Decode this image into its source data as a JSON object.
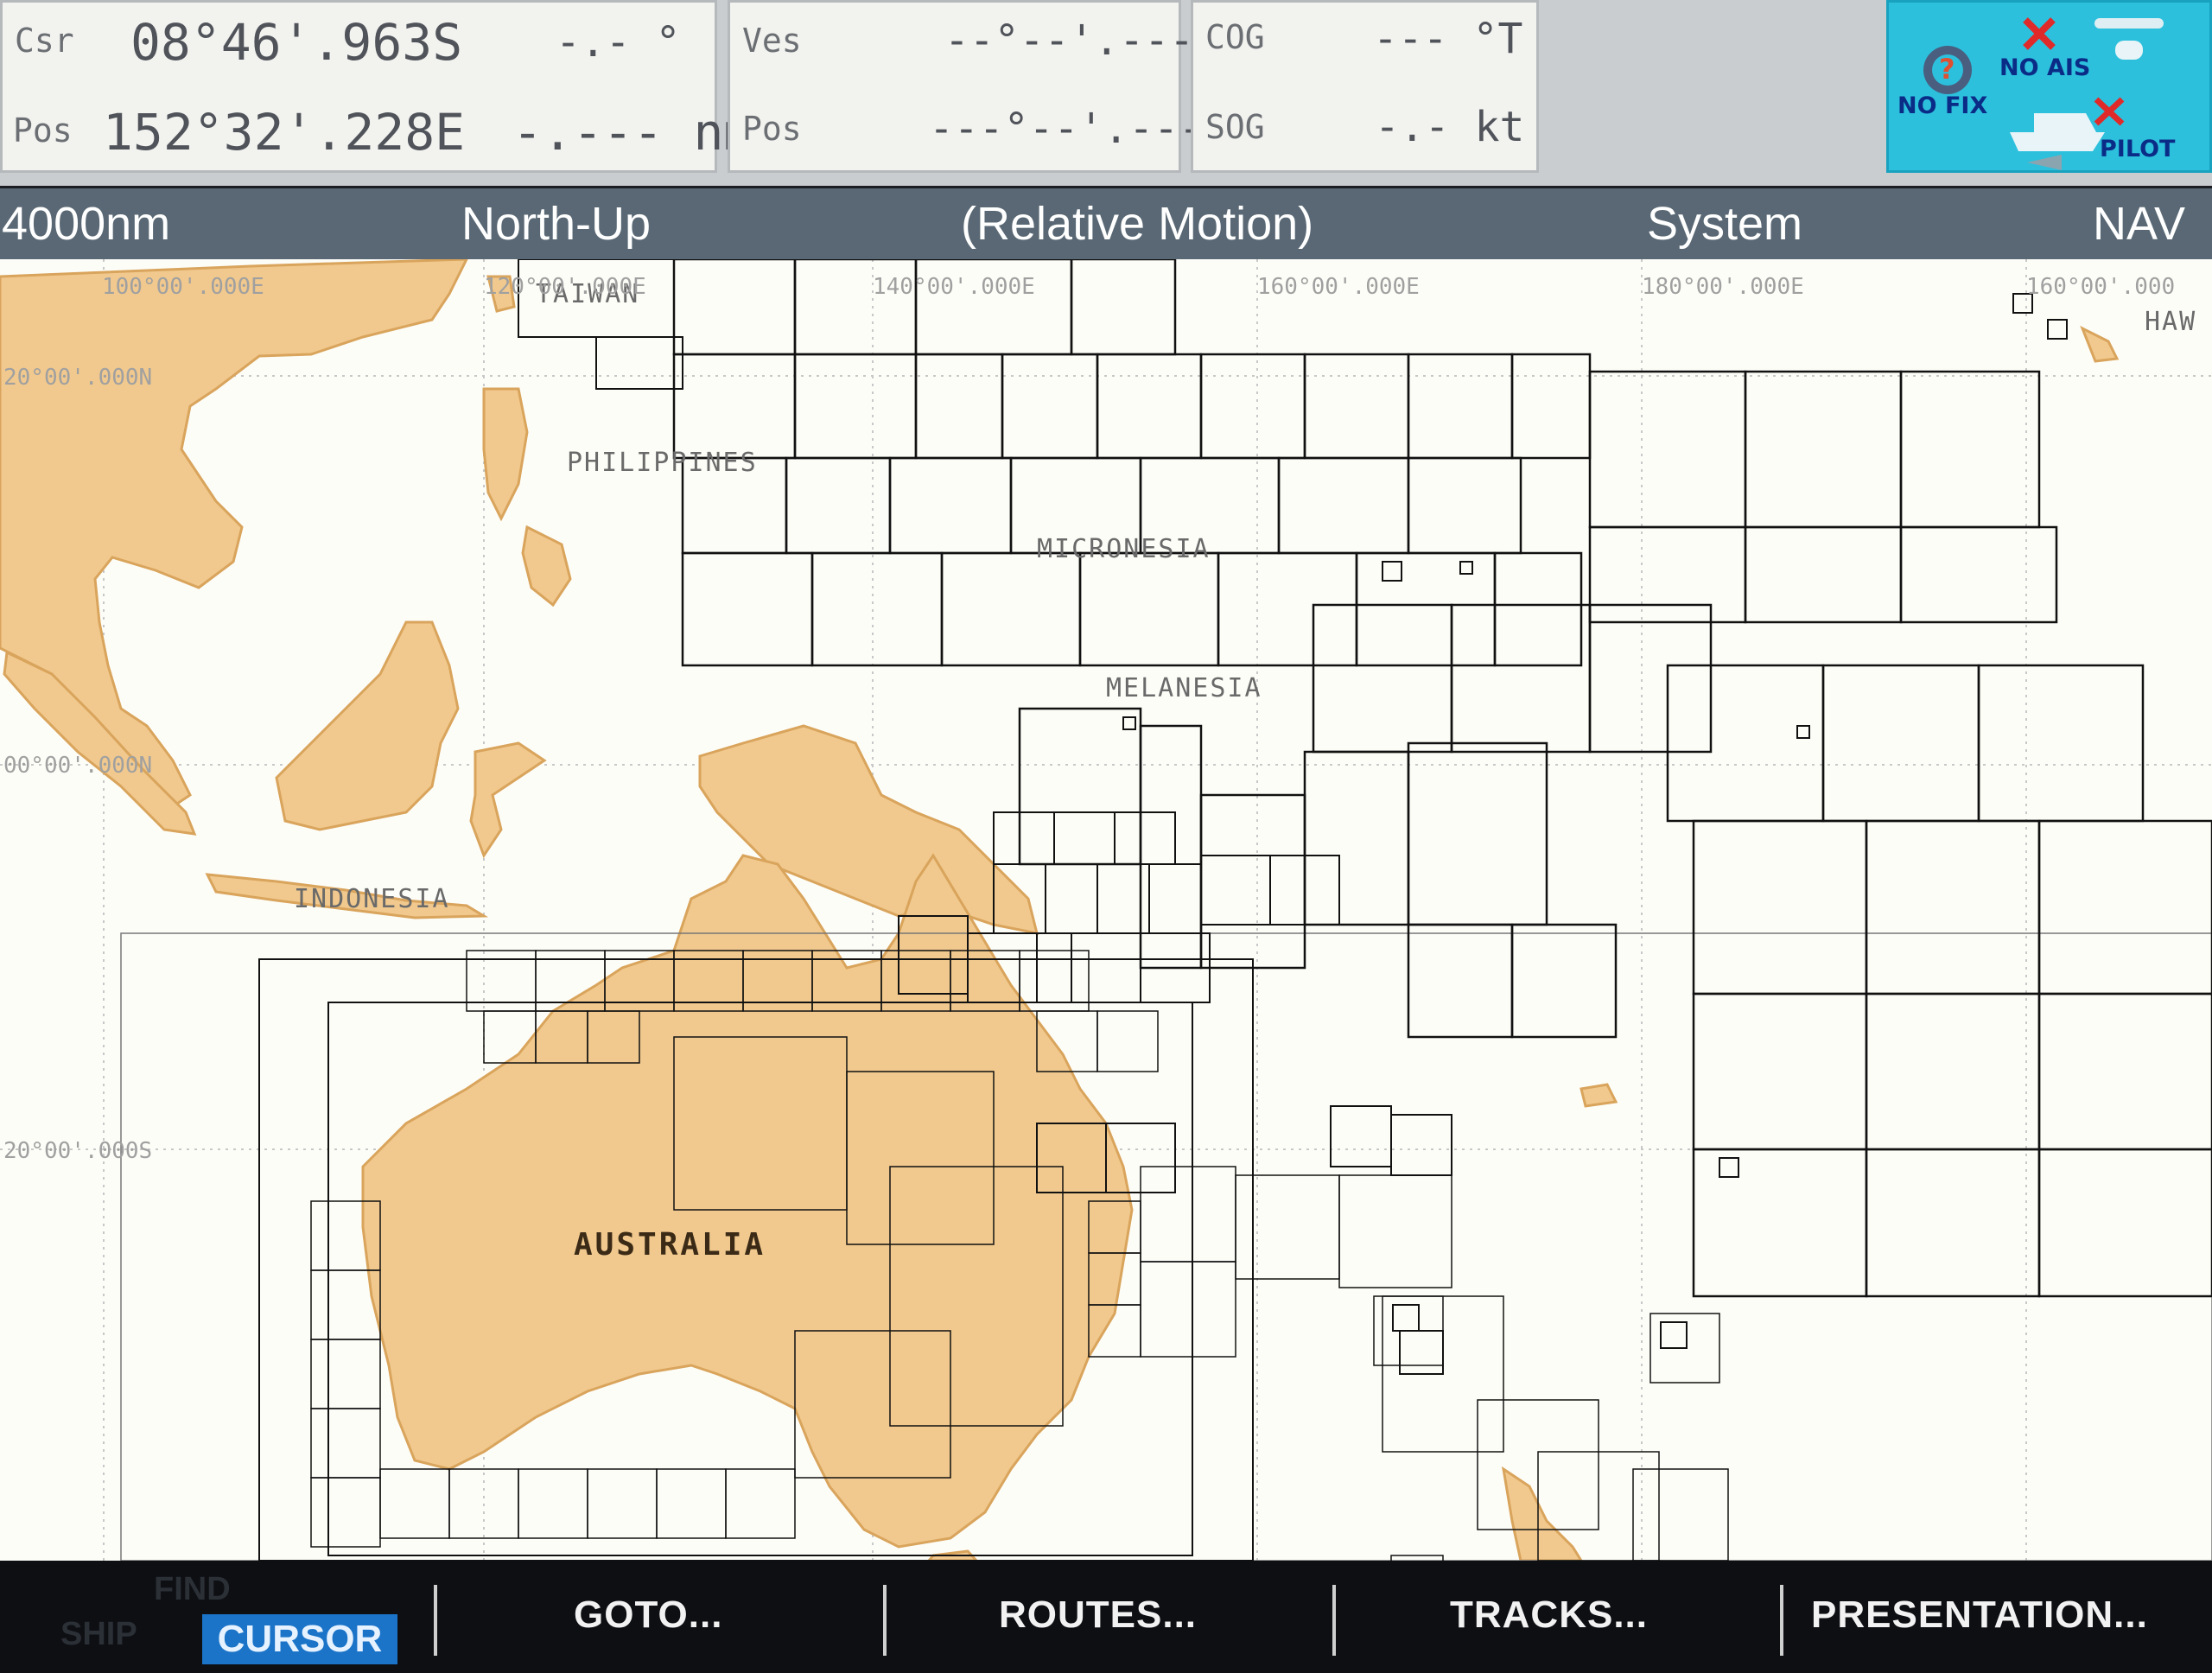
{
  "top": {
    "cursor": {
      "label": "Csr",
      "lat": "08°46'.963S",
      "brg": "-.- °"
    },
    "cursor_pos": {
      "label": "Pos",
      "lon": "152°32'.228E",
      "rng": "-.--- nm"
    },
    "vessel": {
      "label": "Ves",
      "lat": "--°--'.---"
    },
    "vessel_pos": {
      "label": "Pos",
      "lon": "---°--'.---"
    },
    "cog": {
      "label": "COG",
      "value": "--- °T"
    },
    "sog": {
      "label": "SOG",
      "value": "-.- kt"
    }
  },
  "status": {
    "no_ais": "NO AIS",
    "no_fix": "NO FIX",
    "pilot": "PILOT"
  },
  "header": {
    "range": "4000nm",
    "orientation": "North-Up",
    "motion": "(Relative Motion)",
    "datum": "System",
    "mode": "NAV"
  },
  "chart": {
    "longitudes": [
      "100°00'.000E",
      "120°00'.000E",
      "140°00'.000E",
      "160°00'.000E",
      "180°00'.000E",
      "160°00'.000"
    ],
    "latitudes": [
      "20°00'.000N",
      "00°00'.000N",
      "20°00'.000S"
    ],
    "regions": {
      "taiwan": "TAIWAN",
      "philippines": "PHILIPPINES",
      "micronesia": "MICRONESIA",
      "melanesia": "MELANESIA",
      "indonesia": "INDONESIA",
      "australia": "AUSTRALIA",
      "hawaii": "HAW"
    },
    "colors": {
      "land": "#f1c98e",
      "land_edge": "#d9a45c",
      "sea": "#fdfdf8",
      "cells": "#111111"
    }
  },
  "softkeys": {
    "cursor": "CURSOR",
    "goto": "GOTO...",
    "routes": "ROUTES...",
    "tracks": "TRACKS...",
    "presentation": "PRESENTATION..."
  },
  "ghost_keys": {
    "find": "FIND",
    "ship": "SHIP"
  }
}
